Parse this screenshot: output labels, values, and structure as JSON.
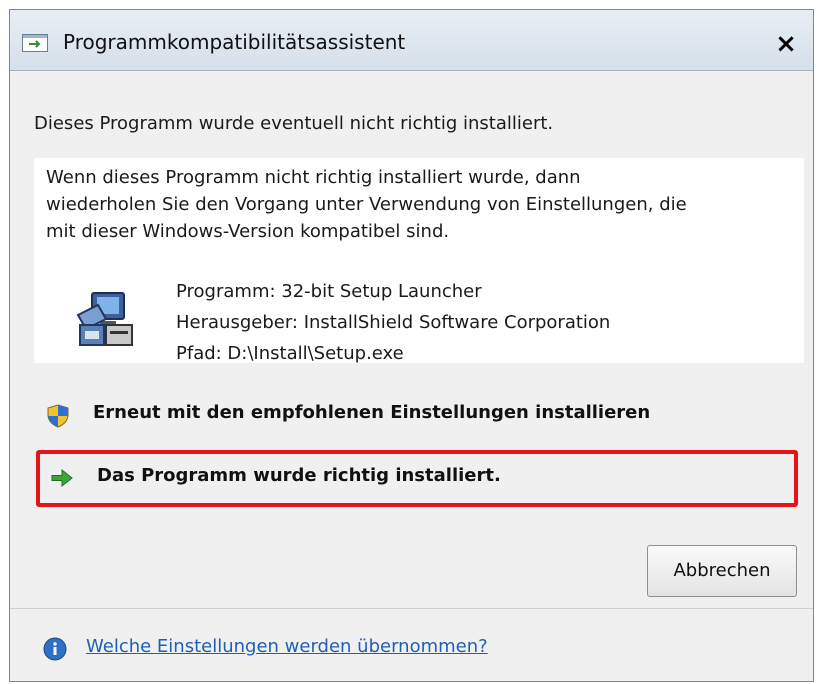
{
  "window": {
    "title": "Programmkompatibilitätsassistent",
    "close_label": "×"
  },
  "heading": "Dieses Programm wurde eventuell nicht richtig installiert.",
  "panel": {
    "description_lines": [
      "Wenn dieses Programm nicht richtig installiert wurde, dann",
      "wiederholen Sie den Vorgang unter Verwendung von Einstellungen, die",
      "mit dieser Windows-Version kompatibel sind."
    ],
    "program": "Programm: 32-bit Setup Launcher",
    "publisher": "Herausgeber: InstallShield Software Corporation",
    "path": "Pfad: D:\\Install\\Setup.exe",
    "icon": "setup-program-icon"
  },
  "options": [
    {
      "label": "Erneut mit den empfohlenen Einstellungen installieren",
      "icon": "shield-icon"
    },
    {
      "label": "Das Programm wurde richtig installiert.",
      "icon": "green-arrow-icon",
      "highlighted": true
    }
  ],
  "cancel_label": "Abbrechen",
  "footer": {
    "link_text": "Welche Einstellungen werden übernommen?",
    "icon": "info-icon"
  },
  "colors": {
    "highlight_border": "#e3141b",
    "link": "#1f5fb4",
    "arrow": "#3aa63a"
  }
}
